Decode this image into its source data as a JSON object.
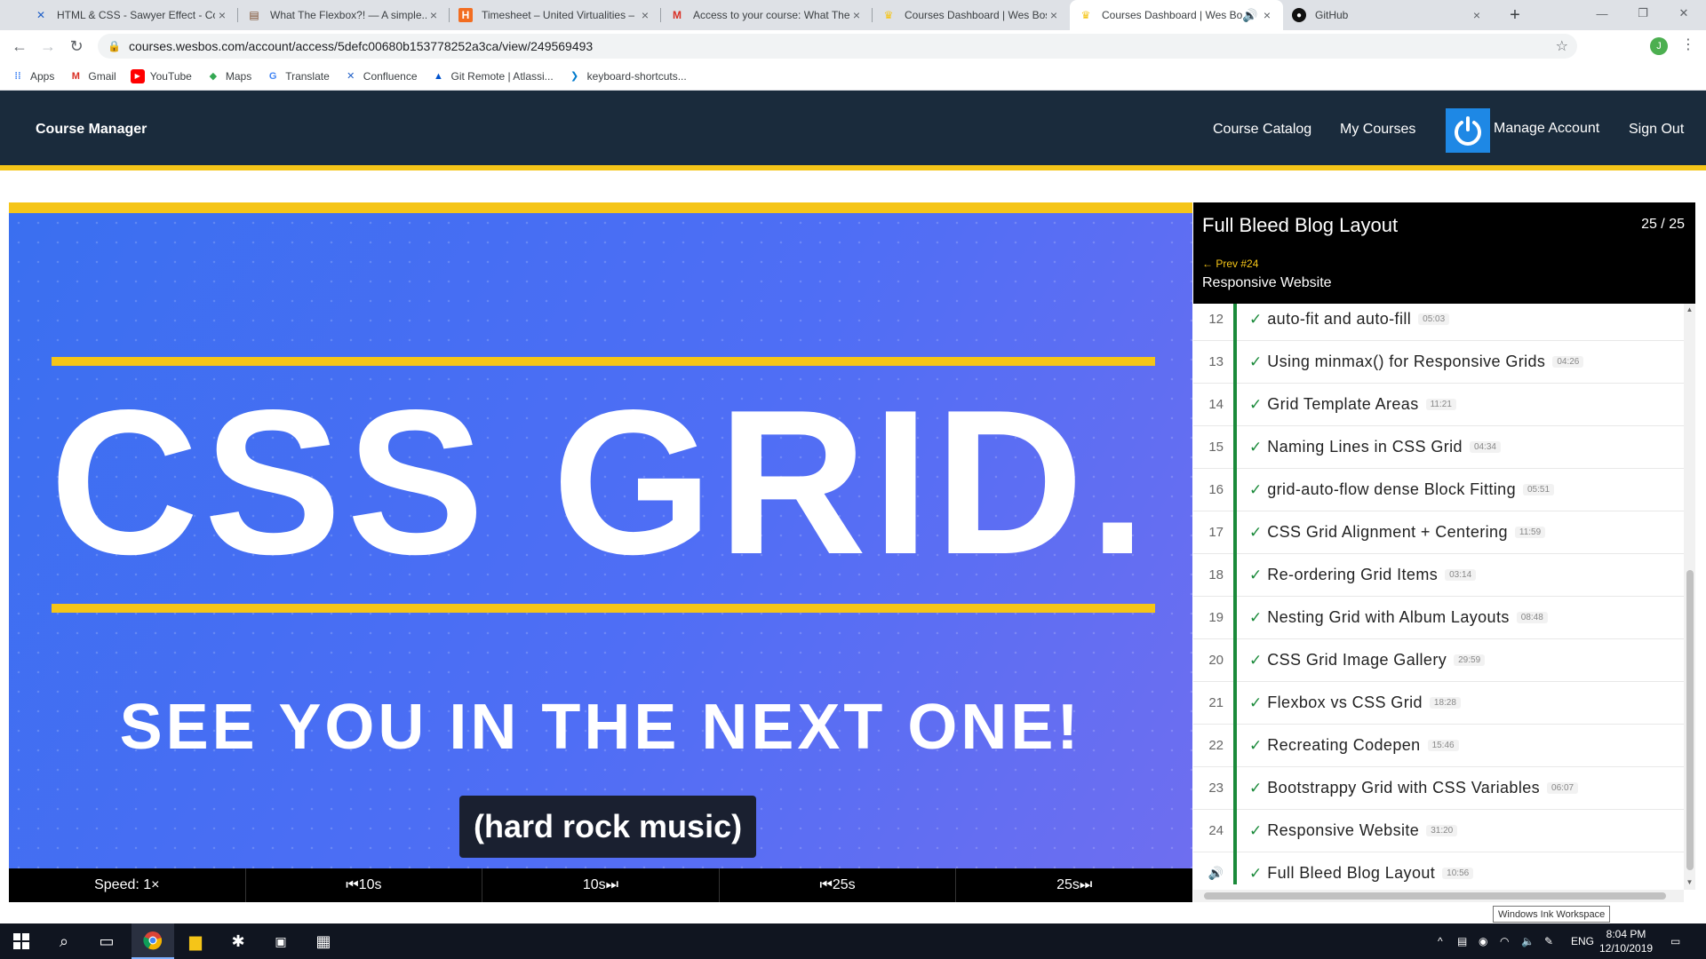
{
  "browser": {
    "tabs": [
      {
        "title": "HTML & CSS - Sawyer Effect - Co",
        "icon": "confluence-icon",
        "color": "#1f5fc7"
      },
      {
        "title": "What The Flexbox?! — A simple...",
        "icon": "page-icon",
        "color": "#7a4a2a"
      },
      {
        "title": "Timesheet – United Virtualities –",
        "icon": "harvest-icon",
        "color": "#f26d21"
      },
      {
        "title": "Access to your course: What The",
        "icon": "gmail-icon",
        "color": "#d93025"
      },
      {
        "title": "Courses Dashboard | Wes Bos",
        "icon": "crown-icon",
        "color": "#f5c518"
      },
      {
        "title": "Courses Dashboard | Wes Bo",
        "icon": "crown-icon",
        "color": "#f5c518",
        "active": true
      },
      {
        "title": "GitHub",
        "icon": "github-icon",
        "color": "#111111"
      }
    ],
    "url": "courses.wesbos.com/account/access/5defc00680b153778252a3ca/view/249569493",
    "profile_initial": "J",
    "bookmarks": [
      "Apps",
      "Gmail",
      "YouTube",
      "Maps",
      "Translate",
      "Confluence",
      "Git Remote | Atlassi...",
      "keyboard-shortcuts..."
    ]
  },
  "header": {
    "brand": "Course Manager",
    "nav": [
      "Course Catalog",
      "My Courses",
      "Manage Account",
      "Sign Out"
    ]
  },
  "video": {
    "title": "CSS GRID.",
    "subtitle": "SEE YOU IN THE NEXT ONE!",
    "caption": "(hard rock music)",
    "controls": {
      "speed": "Speed: 1×",
      "back10": "⏮10s",
      "fwd10": "10s⏭",
      "back25": "⏮25s",
      "fwd25": "25s⏭"
    }
  },
  "sidebar": {
    "title": "Full Bleed Blog Layout",
    "count": "25 / 25",
    "prev_link": "← Prev #24",
    "prev_name": "Responsive Website",
    "lessons": [
      {
        "num": "12",
        "name": "auto-fit and auto-fill",
        "dur": "05:03"
      },
      {
        "num": "13",
        "name": "Using minmax() for Responsive Grids",
        "dur": "04:26"
      },
      {
        "num": "14",
        "name": "Grid Template Areas",
        "dur": "11:21"
      },
      {
        "num": "15",
        "name": "Naming Lines in CSS Grid",
        "dur": "04:34"
      },
      {
        "num": "16",
        "name": "grid-auto-flow dense Block Fitting",
        "dur": "05:51"
      },
      {
        "num": "17",
        "name": "CSS Grid Alignment + Centering",
        "dur": "11:59"
      },
      {
        "num": "18",
        "name": "Re-ordering Grid Items",
        "dur": "03:14"
      },
      {
        "num": "19",
        "name": "Nesting Grid with Album Layouts",
        "dur": "08:48"
      },
      {
        "num": "20",
        "name": "CSS Grid Image Gallery",
        "dur": "29:59"
      },
      {
        "num": "21",
        "name": "Flexbox vs CSS Grid",
        "dur": "18:28"
      },
      {
        "num": "22",
        "name": "Recreating Codepen",
        "dur": "15:46"
      },
      {
        "num": "23",
        "name": "Bootstrappy Grid with CSS Variables",
        "dur": "06:07"
      },
      {
        "num": "24",
        "name": "Responsive Website",
        "dur": "31:20"
      },
      {
        "num": "",
        "name": "Full Bleed Blog Layout",
        "dur": "10:56",
        "current": true
      }
    ]
  },
  "tooltip": "Windows Ink Workspace",
  "taskbar": {
    "language": "ENG",
    "time": "8:04 PM",
    "date": "12/10/2019"
  },
  "colors": {
    "header_bg": "#1a2b3c",
    "accent_yellow": "#f5c518",
    "video_blue": "#4f6ef5",
    "lesson_green": "#1a8a3a"
  }
}
